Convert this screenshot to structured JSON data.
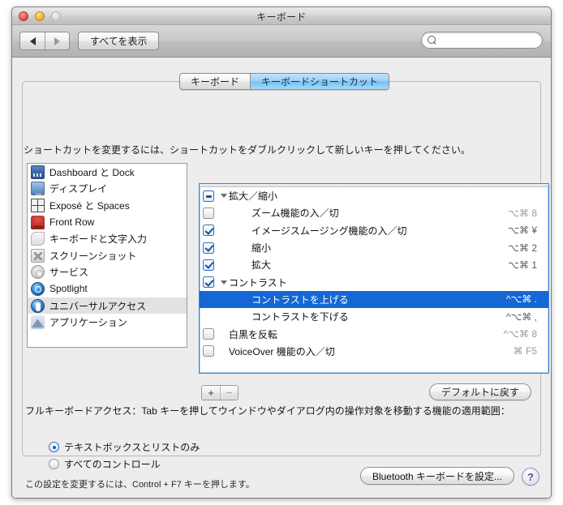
{
  "window": {
    "title": "キーボード",
    "traffic": {
      "close": "close-button",
      "minimize": "minimize-button",
      "zoom": "zoom-button"
    }
  },
  "toolbar": {
    "back_glyph": "◀",
    "forward_glyph": "▶",
    "show_all_label": "すべてを表示",
    "search": {
      "value": "",
      "placeholder": ""
    }
  },
  "tabs": [
    {
      "label": "キーボード",
      "active": false
    },
    {
      "label": "キーボードショートカット",
      "active": true
    }
  ],
  "hint": "ショートカットを変更するには、ショートカットをダブルクリックして新しいキーを押してください。",
  "sidebar": {
    "items": [
      {
        "label": "Dashboard と Dock",
        "icon": "dashboard-dock-icon",
        "selected": false
      },
      {
        "label": "ディスプレイ",
        "icon": "display-icon",
        "selected": false
      },
      {
        "label": "Exposé と Spaces",
        "icon": "expose-spaces-icon",
        "selected": false
      },
      {
        "label": "Front Row",
        "icon": "front-row-icon",
        "selected": false
      },
      {
        "label": "キーボードと文字入力",
        "icon": "keyboard-text-input-icon",
        "selected": false
      },
      {
        "label": "スクリーンショット",
        "icon": "screenshot-icon",
        "selected": false
      },
      {
        "label": "サービス",
        "icon": "services-icon",
        "selected": false
      },
      {
        "label": "Spotlight",
        "icon": "spotlight-icon",
        "selected": false
      },
      {
        "label": "ユニバーサルアクセス",
        "icon": "universal-access-icon",
        "selected": true
      },
      {
        "label": "アプリケーション",
        "icon": "applications-icon",
        "selected": false
      }
    ]
  },
  "shortcuts": {
    "rows": [
      {
        "name": "拡大／縮小",
        "key": "",
        "type": "group",
        "checkbox": "mixed",
        "disclosure": true,
        "selected": false
      },
      {
        "name": "ズーム機能の入／切",
        "key": "⌥⌘ 8",
        "type": "child",
        "checkbox": "off",
        "disclosure": false,
        "selected": false,
        "dim": true
      },
      {
        "name": "イメージスムージング機能の入／切",
        "key": "⌥⌘ ¥",
        "type": "child",
        "checkbox": "on",
        "disclosure": false,
        "selected": false,
        "dim": false
      },
      {
        "name": "縮小",
        "key": "⌥⌘ 2",
        "type": "child",
        "checkbox": "on",
        "disclosure": false,
        "selected": false,
        "dim": false
      },
      {
        "name": "拡大",
        "key": "⌥⌘ 1",
        "type": "child",
        "checkbox": "on",
        "disclosure": false,
        "selected": false,
        "dim": false
      },
      {
        "name": "コントラスト",
        "key": "",
        "type": "group",
        "checkbox": "on",
        "disclosure": true,
        "selected": false
      },
      {
        "name": "コントラストを上げる",
        "key": "^⌥⌘ .",
        "type": "child",
        "checkbox": "none",
        "disclosure": false,
        "selected": true,
        "dim": false
      },
      {
        "name": "コントラストを下げる",
        "key": "^⌥⌘ ,",
        "type": "child",
        "checkbox": "none",
        "disclosure": false,
        "selected": false,
        "dim": false
      },
      {
        "name": "白黒を反転",
        "key": "^⌥⌘ 8",
        "type": "child-nopad",
        "checkbox": "off",
        "disclosure": false,
        "selected": false,
        "dim": true
      },
      {
        "name": "VoiceOver 機能の入／切",
        "key": "⌘ F5",
        "type": "child-nopad",
        "checkbox": "off",
        "disclosure": false,
        "selected": false,
        "dim": true
      }
    ]
  },
  "list_controls": {
    "add_label": "+",
    "remove_label": "−",
    "defaults_label": "デフォルトに戻す"
  },
  "full_keyboard_access": {
    "description": "フルキーボードアクセス：Tab キーを押してウインドウやダイアログ内の操作対象を移動する機能の適用範囲：",
    "options": [
      {
        "label": "テキストボックスとリストのみ",
        "selected": true
      },
      {
        "label": "すべてのコントロール",
        "selected": false
      }
    ],
    "note": "この設定を変更するには、Control + F7 キーを押します。"
  },
  "footer": {
    "bluetooth_label": "Bluetooth キーボードを設定...",
    "help_label": "?"
  }
}
